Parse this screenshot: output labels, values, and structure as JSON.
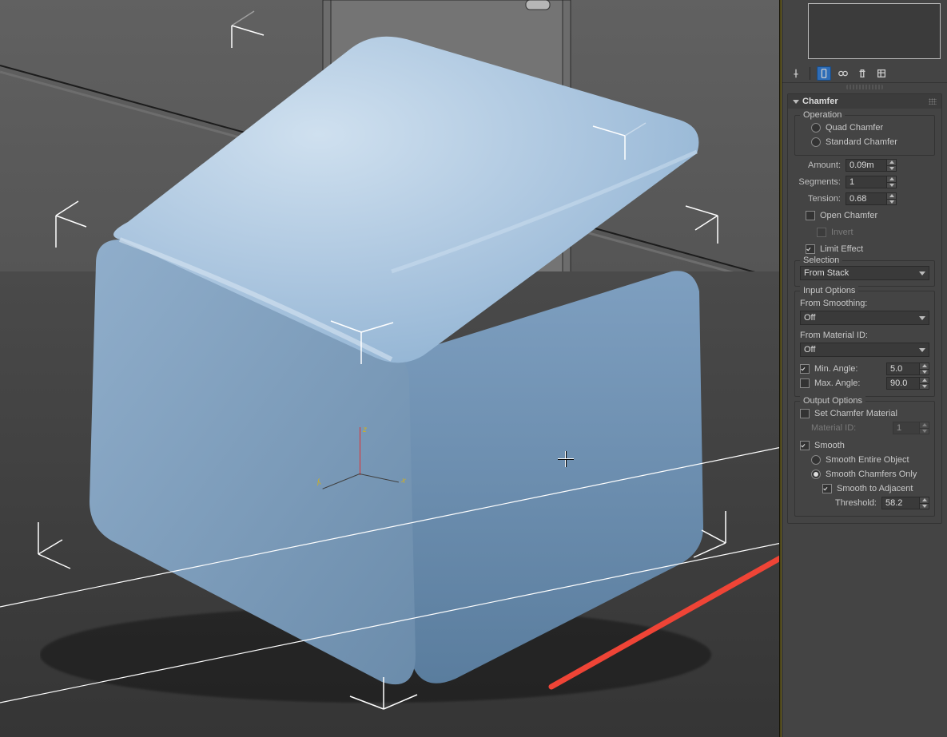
{
  "rollout": {
    "title": "Chamfer"
  },
  "operation": {
    "legend": "Operation",
    "quad": "Quad Chamfer",
    "std": "Standard Chamfer",
    "selected": "none"
  },
  "params": {
    "amount_label": "Amount:",
    "amount": "0.09m",
    "segments_label": "Segments:",
    "segments": "1",
    "tension_label": "Tension:",
    "tension": "0.68",
    "open_chamfer": "Open Chamfer",
    "invert": "Invert",
    "limit_effect": "Limit Effect"
  },
  "selection": {
    "legend": "Selection",
    "value": "From Stack"
  },
  "input": {
    "legend": "Input Options",
    "from_smoothing_label": "From Smoothing:",
    "from_smoothing": "Off",
    "from_matid_label": "From Material ID:",
    "from_matid": "Off",
    "min_angle_label": "Min. Angle:",
    "min_angle": "5.0",
    "max_angle_label": "Max. Angle:",
    "max_angle": "90.0"
  },
  "output": {
    "legend": "Output Options",
    "set_chamfer_mat": "Set Chamfer Material",
    "material_id_label": "Material ID:",
    "material_id": "1",
    "smooth": "Smooth",
    "smooth_entire": "Smooth Entire Object",
    "smooth_chamfers": "Smooth Chamfers Only",
    "smooth_adjacent": "Smooth to Adjacent",
    "threshold_label": "Threshold:",
    "threshold": "58.2"
  },
  "axis": {
    "x": "x",
    "y": "y",
    "z": "z"
  }
}
